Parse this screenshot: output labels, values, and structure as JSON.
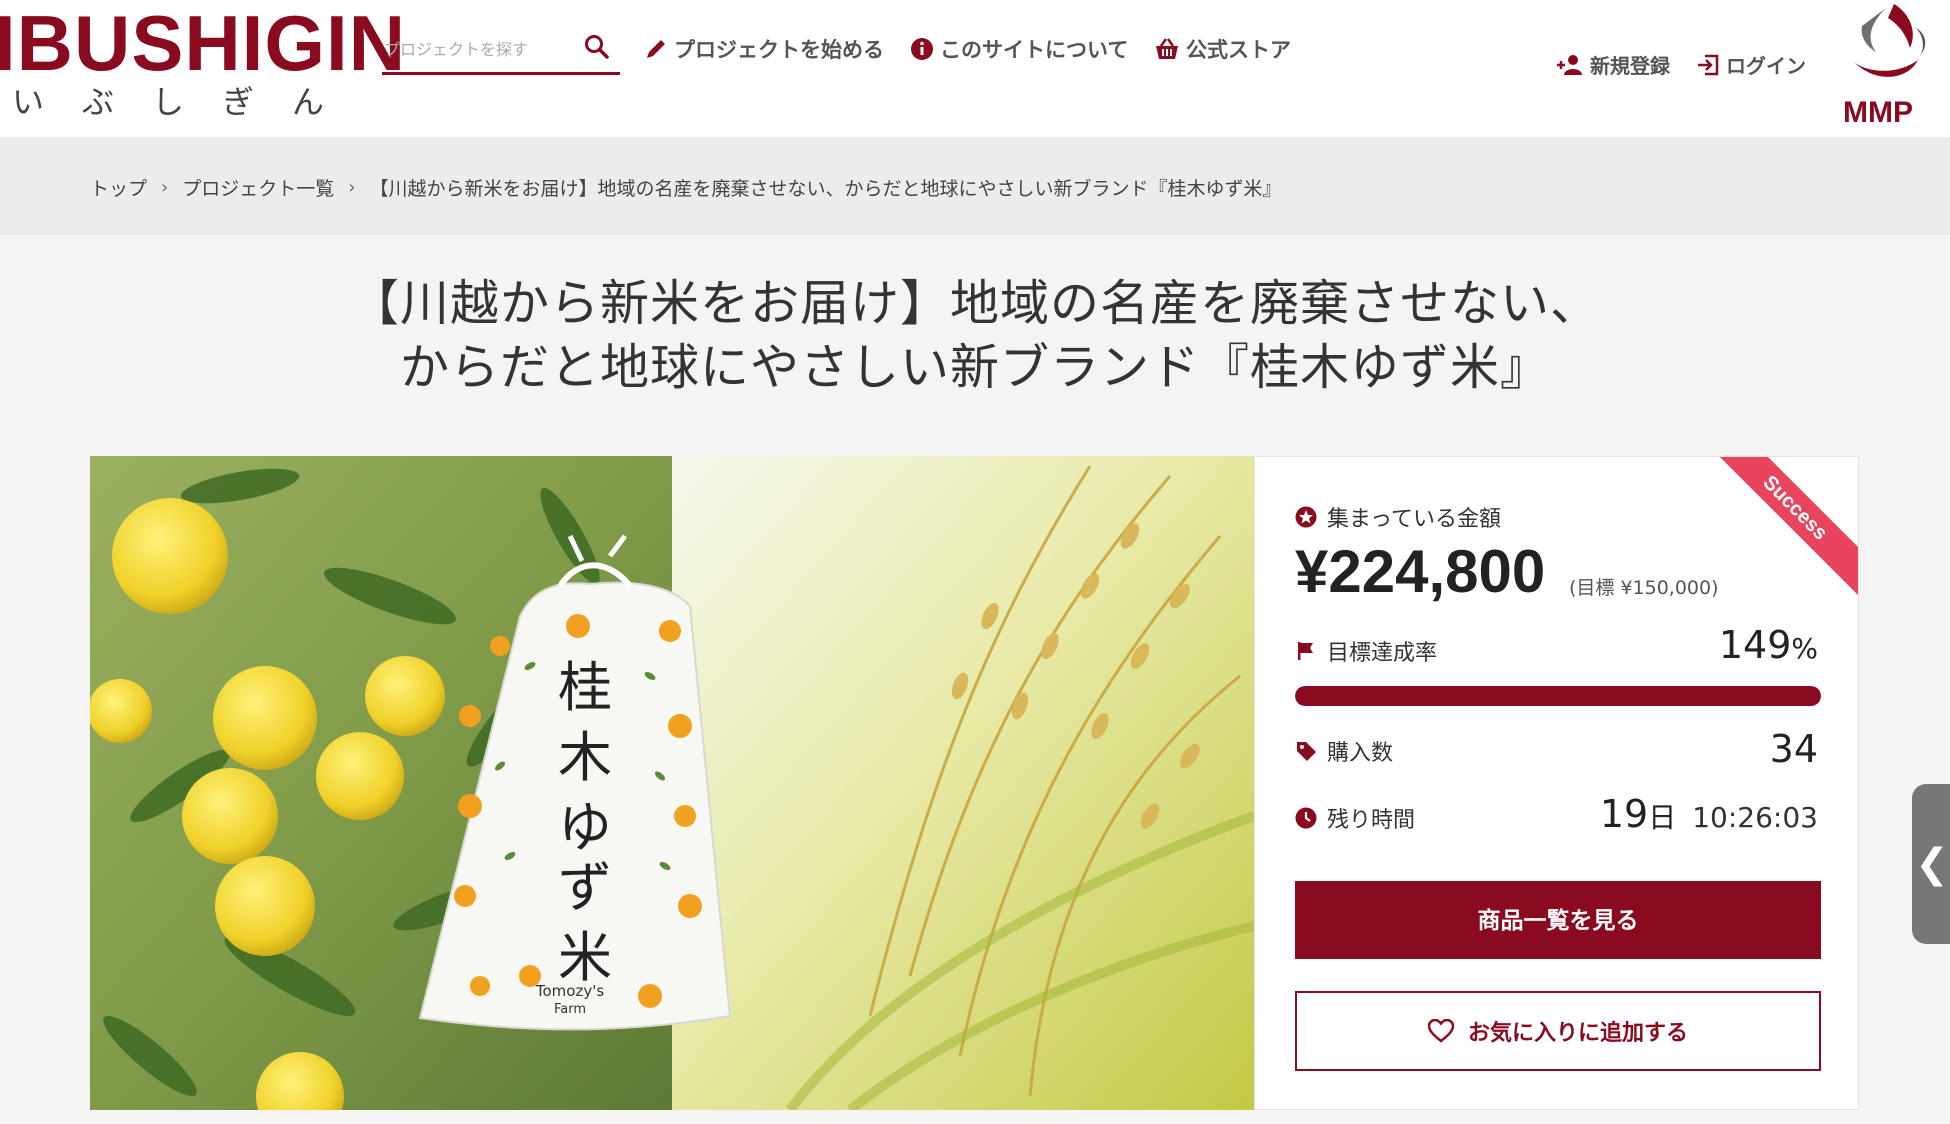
{
  "header": {
    "logo_text": "IBUSHIGIN",
    "logo_sub": "いぶしぎん",
    "search_placeholder": "プロジェクトを探す",
    "nav": {
      "start_project": "プロジェクトを始める",
      "about": "このサイトについて",
      "store": "公式ストア"
    },
    "auth": {
      "register": "新規登録",
      "login": "ログイン"
    },
    "partner_logo": "MMP"
  },
  "breadcrumb": {
    "items": [
      "トップ",
      "プロジェクト一覧",
      "【川越から新米をお届け】地域の名産を廃棄させない、からだと地球にやさしい新ブランド『桂木ゆず米』"
    ],
    "separator": "›"
  },
  "project": {
    "title_line1": "【川越から新米をお届け】地域の名産を廃棄させない、",
    "title_line2": "からだと地球にやさしい新ブランド『桂木ゆず米』",
    "image": {
      "bag_text": "桂木ゆず米",
      "bag_brand_line1": "Tomozy's",
      "bag_brand_line2": "Farm"
    }
  },
  "stats": {
    "ribbon": "Success",
    "raised_label": "集まっている金額",
    "raised_amount": "¥224,800",
    "goal_text": "(目標 ¥150,000)",
    "achievement_label": "目標達成率",
    "achievement_value": "149",
    "achievement_unit": "%",
    "progress_fraction": 1.0,
    "purchases_label": "購入数",
    "purchases_value": "34",
    "remaining_label": "残り時間",
    "remaining_days": "19",
    "remaining_days_unit": "日",
    "remaining_time": "10:26:03"
  },
  "actions": {
    "view_items": "商品一覧を見る",
    "favorite": "お気に入りに追加する"
  },
  "colors": {
    "brand": "#8a0b1f",
    "ribbon": "#e8445d"
  },
  "side_tab": "❮"
}
